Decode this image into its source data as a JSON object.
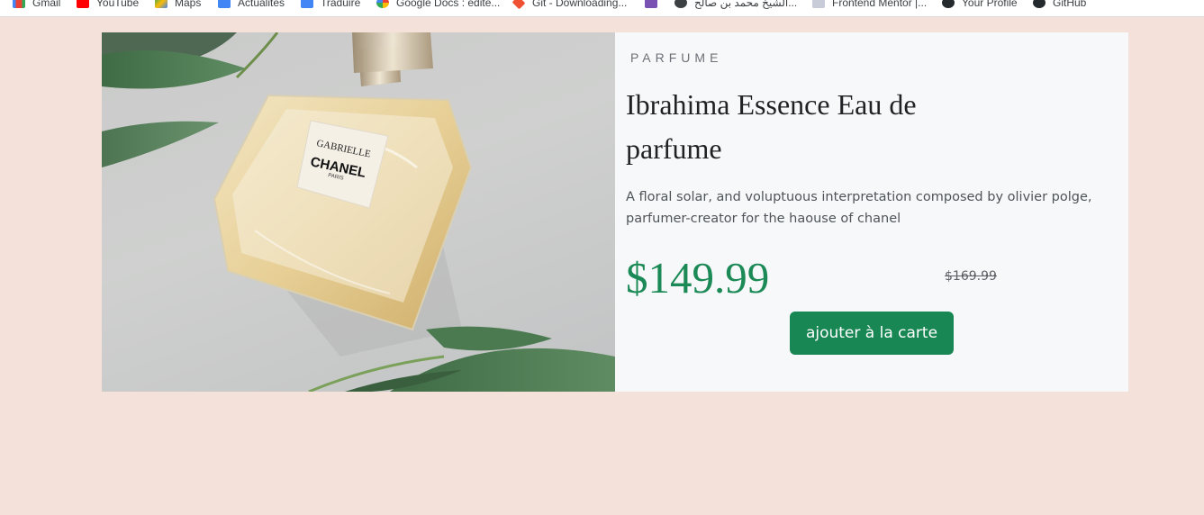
{
  "bookmarks": [
    {
      "label": "Gmail",
      "icon": "gmail-icon",
      "color": "#ea4335"
    },
    {
      "label": "YouTube",
      "icon": "youtube-icon",
      "color": "#ff0000"
    },
    {
      "label": "Maps",
      "icon": "maps-icon",
      "color": "#34a853"
    },
    {
      "label": "Actualités",
      "icon": "news-icon",
      "color": "#4285f4"
    },
    {
      "label": "Traduire",
      "icon": "translate-icon",
      "color": "#4285f4"
    },
    {
      "label": "Google Docs : édite...",
      "icon": "google-icon",
      "color": "#4285f4"
    },
    {
      "label": "Git - Downloading...",
      "icon": "git-icon",
      "color": "#f05133"
    },
    {
      "label": "",
      "icon": "bootstrap-icon",
      "color": "#7952b3"
    },
    {
      "label": "الشيخ محمد بن صالح...",
      "icon": "globe-icon",
      "color": "#3c4043"
    },
    {
      "label": "Frontend Mentor |...",
      "icon": "frontend-mentor-icon",
      "color": "#3e54a3"
    },
    {
      "label": "Your Profile",
      "icon": "github-icon",
      "color": "#24292e"
    },
    {
      "label": "GitHub",
      "icon": "github-icon",
      "color": "#24292e"
    }
  ],
  "product": {
    "category": "PARFUME",
    "title": "Ibrahima Essence Eau de parfume",
    "description": "A floral solar, and voluptuous interpretation composed by olivier polge, parfumer-creator for the haouse of chanel",
    "price": "$149.99",
    "old_price": "$169.99",
    "cart_button": "ajouter à la carte",
    "image": {
      "label_line1": "GABRIELLE",
      "label_line2": "CHANEL",
      "label_line3": "PARIS"
    }
  },
  "colors": {
    "page_background": "#f3e1da",
    "card_background": "#f7f8fa",
    "price": "#1b8a56",
    "button": "#198754"
  }
}
